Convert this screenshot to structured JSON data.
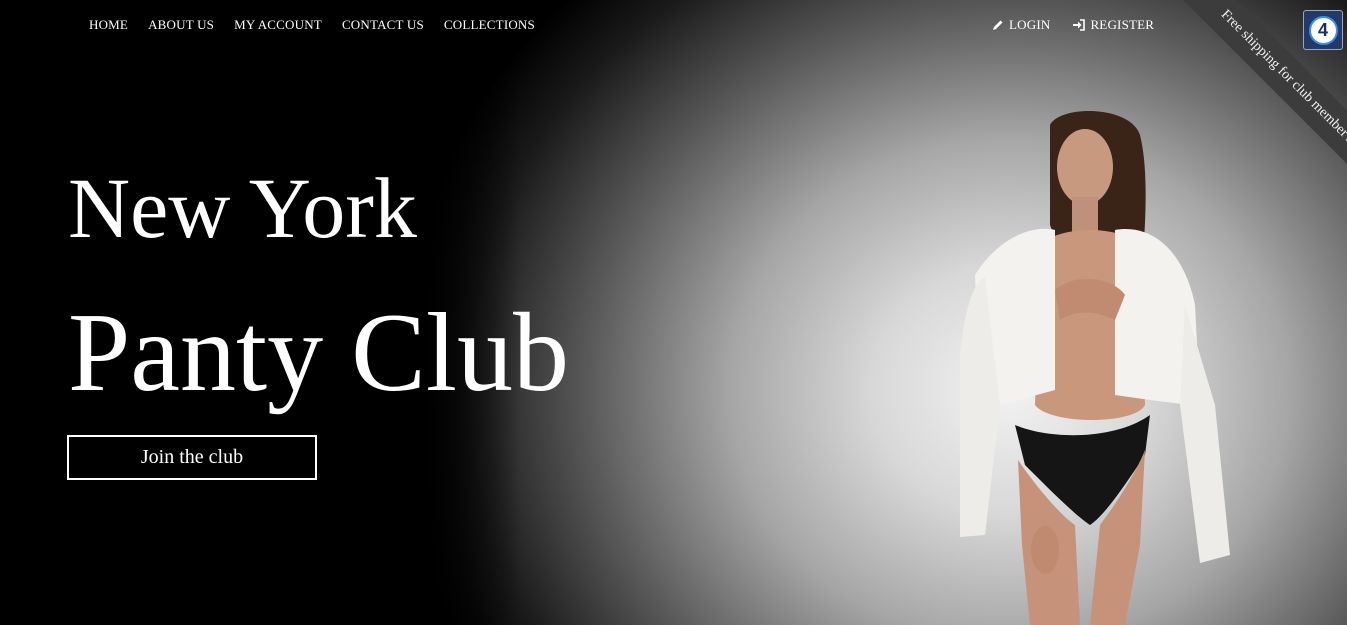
{
  "nav": {
    "items": [
      {
        "label": "HOME"
      },
      {
        "label": "ABOUT US"
      },
      {
        "label": "MY ACCOUNT"
      },
      {
        "label": "CONTACT US"
      },
      {
        "label": "COLLECTIONS"
      }
    ]
  },
  "auth": {
    "login_label": "LOGIN",
    "register_label": "REGISTER",
    "login_icon": "pencil-icon",
    "register_icon": "sign-in-icon"
  },
  "ribbon": {
    "text": "Free shipping for club member's"
  },
  "badge": {
    "text": "4"
  },
  "hero": {
    "line1": "New York",
    "line2": "Panty Club",
    "cta_label": "Join the club"
  },
  "colors": {
    "background": "#000000",
    "text": "#ffffff",
    "ribbon": "#3c3c3c",
    "badge": "#243a66"
  }
}
